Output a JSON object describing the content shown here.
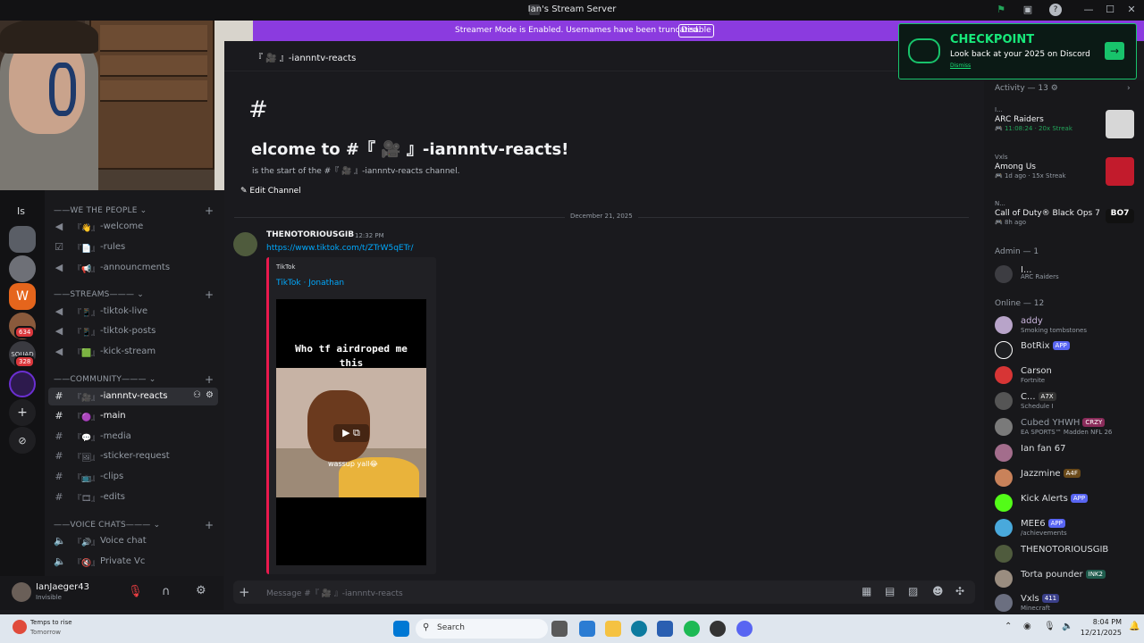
{
  "window": {
    "title": "Ian's Stream Server"
  },
  "banner": {
    "message": "Streamer Mode is Enabled. Usernames have been truncated.",
    "button": "Disable"
  },
  "channel_header": {
    "name": "『 🎥 』-iannntv-reacts"
  },
  "welcome": {
    "hash": "#",
    "title": "elcome to #『 🎥 』-iannntv-reacts!",
    "subtitle": "is the start of the #『 🎥 』-iannntv-reacts channel.",
    "edit_button": "Edit Channel"
  },
  "server_rail": {
    "dm_label": "Is",
    "badge_1": "634",
    "badge_2": "328"
  },
  "sidebar": {
    "categories": [
      "WE THE PEOPLE",
      "STREAMS",
      "COMMUNITY",
      "VOICE CHATS"
    ],
    "channels": [
      {
        "emoji": "『👋』",
        "name": "-welcome"
      },
      {
        "emoji": "『📄』",
        "name": "-rules"
      },
      {
        "emoji": "『📢』",
        "name": "-announcments"
      },
      {
        "emoji": "『📱』",
        "name": "-tiktok-live"
      },
      {
        "emoji": "『📱』",
        "name": "-tiktok-posts"
      },
      {
        "emoji": "『🟩』",
        "name": "-kick-stream"
      },
      {
        "emoji": "『🎥』",
        "name": "-iannntv-reacts"
      },
      {
        "emoji": "『🟣』",
        "name": "-main"
      },
      {
        "emoji": "『💬』",
        "name": "-media"
      },
      {
        "emoji": "『🖼』",
        "name": "-sticker-request"
      },
      {
        "emoji": "『📺』",
        "name": "-clips"
      },
      {
        "emoji": "『🎞』",
        "name": "-edits"
      },
      {
        "emoji": "『🔊』",
        "name": "Voice chat"
      },
      {
        "emoji": "『🔇』",
        "name": "Private Vc"
      }
    ]
  },
  "user_panel": {
    "username": "IanJaeger43",
    "status": "Invisible"
  },
  "chat": {
    "date_divider": "December 21, 2025",
    "message": {
      "author": "THENOTORIOUSGIB",
      "time": "12:32 PM",
      "link": "https://www.tiktok.com/t/ZTrW5qETr/",
      "embed_provider": "TikTok",
      "embed_title": "TikTok · Jonathan",
      "video_caption": "Who tf airdroped me this",
      "video_subtitle": "wassup yall😂"
    },
    "composer_placeholder": "Message #『 🎥 』-iannntv-reacts"
  },
  "checkpoint": {
    "title": "CHECKPOINT",
    "subtitle": "Look back at your 2025 on Discord",
    "dismiss": "Dismiss"
  },
  "members": {
    "activity_header": "Activity — 13",
    "activities": [
      {
        "user": "I...",
        "game": "ARC Raiders",
        "detail": "🎮 11:08:24 · 20x Streak"
      },
      {
        "user": "Vxls",
        "game": "Among Us",
        "detail": "🎮 1d ago · 15x Streak"
      },
      {
        "user": "N...",
        "game": "Call of Duty® Black Ops 7",
        "detail": "🎮 8h ago"
      }
    ],
    "admin_header": "Admin — 1",
    "admin": {
      "name": "I...",
      "status": "ARC Raiders"
    },
    "online_header": "Online — 12",
    "online": [
      {
        "name": "addy",
        "status": "Smoking tombstones",
        "tag": ""
      },
      {
        "name": "BotRix",
        "status": "",
        "tag": "APP"
      },
      {
        "name": "Carson",
        "status": "Fortnite",
        "tag": ""
      },
      {
        "name": "C...",
        "status": "Schedule I",
        "tag": "A7X"
      },
      {
        "name": "Cubed YHWH",
        "status": "EA SPORTS™ Madden NFL 26",
        "tag": "CRZY"
      },
      {
        "name": "Ian fan 67",
        "status": "",
        "tag": ""
      },
      {
        "name": "Jazzmine",
        "status": "",
        "tag": "A4F"
      },
      {
        "name": "Kick Alerts",
        "status": "",
        "tag": "APP"
      },
      {
        "name": "MEE6",
        "status": "/achievements",
        "tag": "APP"
      },
      {
        "name": "THENOTORIOUSGIB",
        "status": "",
        "tag": ""
      },
      {
        "name": "Torta pounder",
        "status": "",
        "tag": "INK2"
      },
      {
        "name": "Vxls",
        "status": "Minecraft",
        "tag": "411"
      }
    ]
  },
  "taskbar": {
    "weather_title": "Temps to rise",
    "weather_sub": "Tomorrow",
    "search": "Search",
    "time": "8:04 PM",
    "date": "12/21/2025"
  }
}
